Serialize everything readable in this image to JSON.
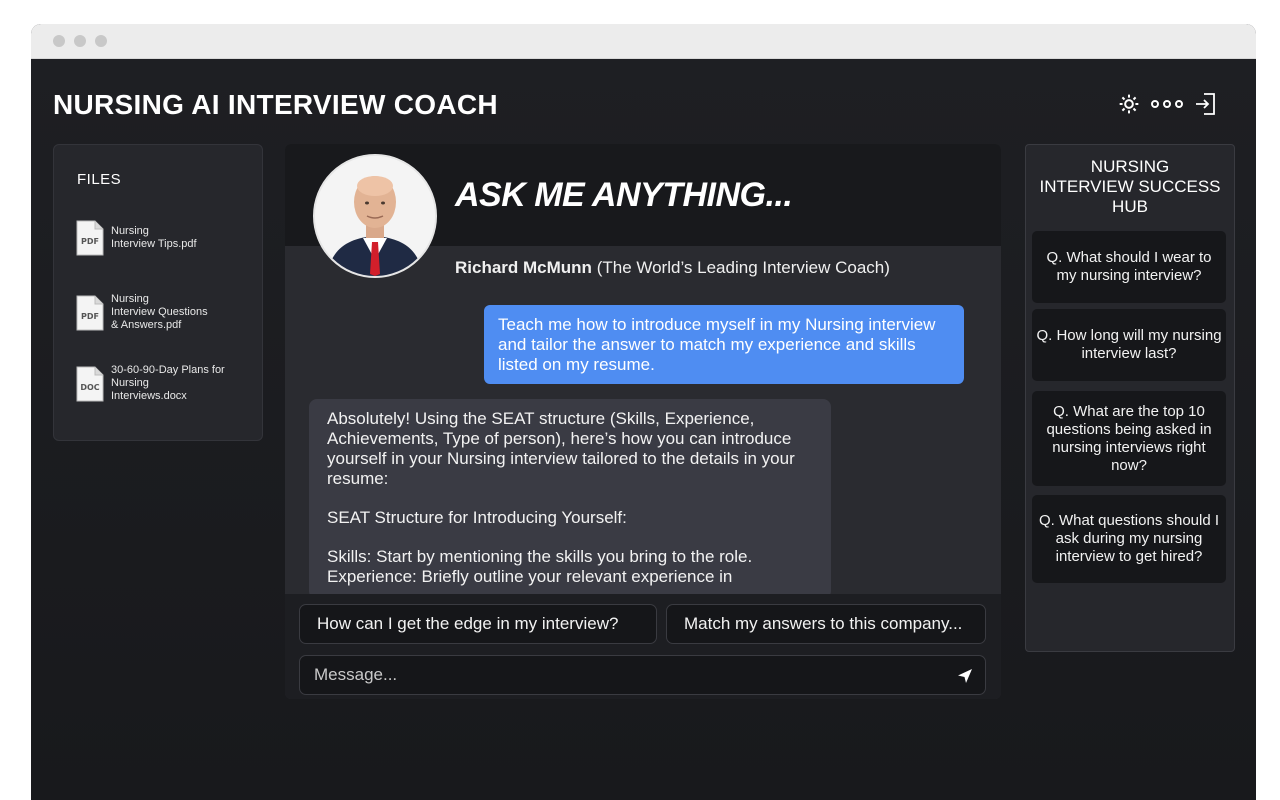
{
  "app": {
    "title": "NURSING AI INTERVIEW COACH"
  },
  "header_icons": [
    "gear-icon",
    "more-icon",
    "logout-icon"
  ],
  "files": {
    "title": "FILES",
    "items": [
      {
        "name": "Nursing\nInterview Tips.pdf",
        "type": "PDF"
      },
      {
        "name": "Nursing\nInterview Questions\n& Answers.pdf",
        "type": "PDF"
      },
      {
        "name": "30-60-90-Day Plans for\nNursing\nInterviews.docx",
        "type": "DOC"
      }
    ]
  },
  "chat": {
    "heading": "ASK ME ANYTHING...",
    "coach_name": "Richard McMunn",
    "coach_tagline": "(The World’s Leading Interview Coach)",
    "user_message": "Teach me how to introduce myself in my Nursing interview and tailor the answer to match my experience and skills listed on my resume.",
    "bot_message": {
      "p1": "Absolutely! Using the SEAT structure (Skills, Experience, Achievements, Type of person), here’s how you can introduce yourself in your Nursing interview tailored to the details in your resume:",
      "p2": "SEAT Structure for Introducing Yourself:",
      "p3": "Skills: Start by mentioning the skills you bring to the role.\nExperience: Briefly outline your relevant experience in"
    },
    "suggestions": [
      "How can I get the edge in my interview?",
      "Match my answers to this company..."
    ],
    "input_placeholder": "Message..."
  },
  "hub": {
    "title": "NURSING\nINTERVIEW SUCCESS\nHUB",
    "questions": [
      "Q. What should I wear to my nursing interview?",
      "Q. How long will my nursing interview last?",
      "Q. What are the top 10 questions being asked in nursing interviews right now?",
      "Q. What questions should I ask during my nursing interview to get hired?"
    ]
  },
  "colors": {
    "accent": "#4f8df2",
    "background": "#1c1d21",
    "bot_bubble": "#3a3b44"
  }
}
